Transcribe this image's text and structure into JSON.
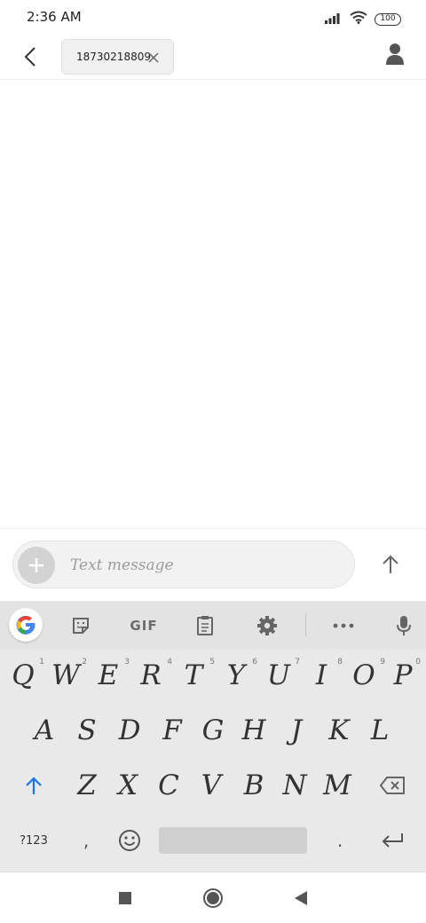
{
  "status_bar": {
    "time": "2:36 AM",
    "battery": "100",
    "icons": [
      "signal-icon",
      "wifi-icon",
      "battery-icon"
    ]
  },
  "header": {
    "back_icon": "chevron-left-icon",
    "recipient": "18730218809",
    "chip_close_icon": "close-icon",
    "contact_icon": "person-icon"
  },
  "compose": {
    "add_icon": "plus-icon",
    "placeholder": "Text message",
    "send_icon": "arrow-up-icon"
  },
  "keyboard": {
    "toolbar": {
      "items": [
        "google-icon",
        "sticker-icon",
        "gif",
        "clipboard-icon",
        "gear-icon",
        "more-icon",
        "mic-icon"
      ],
      "gif_label": "GIF"
    },
    "row1": [
      "Q",
      "W",
      "E",
      "R",
      "T",
      "Y",
      "U",
      "I",
      "O",
      "P"
    ],
    "row1_hints": [
      "1",
      "2",
      "3",
      "4",
      "5",
      "6",
      "7",
      "8",
      "9",
      "0"
    ],
    "row2": [
      "A",
      "S",
      "D",
      "F",
      "G",
      "H",
      "J",
      "K",
      "L"
    ],
    "row3": [
      "Z",
      "X",
      "C",
      "V",
      "B",
      "N",
      "M"
    ],
    "symbols_label": "?123",
    "comma_label": ",",
    "period_label": "."
  },
  "nav_bar": {
    "items": [
      "recents-square-icon",
      "home-circle-icon",
      "back-triangle-icon"
    ]
  },
  "colors": {
    "accent": "#1a73e8",
    "keyboard_bg": "#e9e9e9",
    "toolbar_bg": "#e3e3e3",
    "compose_bg": "#f2f2f2"
  }
}
